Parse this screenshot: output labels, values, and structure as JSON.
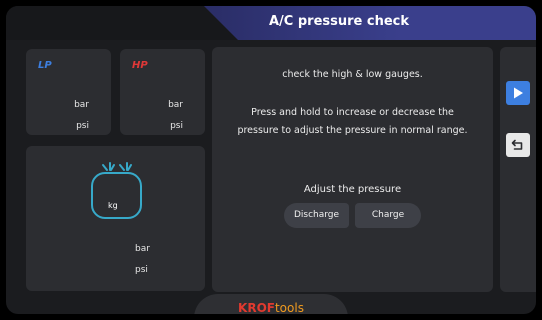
{
  "header": {
    "title": "A/C pressure check"
  },
  "gauges": {
    "lp": {
      "label": "LP",
      "unit_bar": "bar",
      "unit_psi": "psi",
      "color": "#3d7fe0"
    },
    "hp": {
      "label": "HP",
      "unit_bar": "bar",
      "unit_psi": "psi",
      "color": "#e03838"
    }
  },
  "tank": {
    "icon": "refrigerant-tank-icon",
    "unit_kg": "kg",
    "unit_bar": "bar",
    "unit_psi": "psi",
    "color": "#37a9c9"
  },
  "instructions": {
    "line1": "check the high & low gauges.",
    "line2": "Press and hold to increase or decrease the pressure to adjust the pressure in normal range.",
    "adjust_label": "Adjust the pressure",
    "discharge_label": "Discharge",
    "charge_label": "Charge"
  },
  "sidebar": {
    "play_icon": "play-icon",
    "back_icon": "return-icon",
    "accent": "#3d7fe0"
  },
  "footer": {
    "brand_part1": "KROF",
    "brand_part2": "tools"
  }
}
